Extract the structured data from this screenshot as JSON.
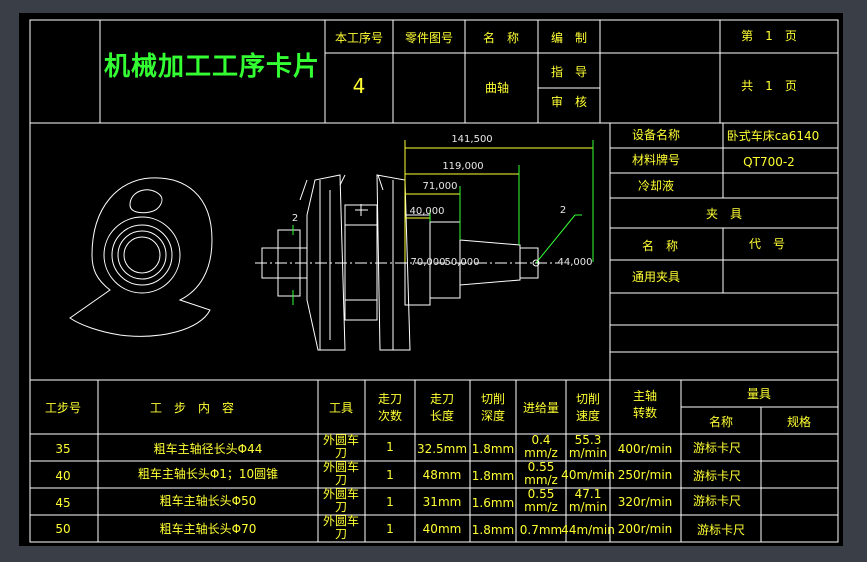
{
  "card_title": "机械加工工序卡片",
  "header": {
    "process_no_label": "本工序号",
    "process_no_value": "4",
    "part_drawing_no_label": "零件图号",
    "name_label": "名　称",
    "part_name": "曲轴",
    "compiled_label": "编　制",
    "guide_label": "指　导",
    "review_label": "审　核",
    "page_label": "第　1　页",
    "total_pages_label": "共　1　页"
  },
  "equipment": {
    "device_name_label": "设备名称",
    "device_name_value": "卧式车床ca6140",
    "material_label": "材料牌号",
    "material_value": "QT700-2",
    "coolant_label": "冷却液",
    "fixture_label": "夹　具",
    "fixture_name_label": "名　称",
    "fixture_code_label": "代　号",
    "fixture_value": "通用夹具"
  },
  "drawing_dims": {
    "d1": "141,500",
    "d2": "119,000",
    "d3": "71,000",
    "d4": "40,000",
    "d5": "44,000",
    "d6": "70,000",
    "d7": "50,000",
    "mark_left": "2",
    "mark_right": "2"
  },
  "table": {
    "headers": {
      "step_no": "工步号",
      "content": "工　步　内　容",
      "tool": "工具",
      "passes": "走刀次数",
      "length": "走刀长度",
      "depth": "切削深度",
      "feed": "进给量",
      "speed": "切削速度",
      "spindle": "主轴转数",
      "gauge": "量具",
      "gauge_name": "名称",
      "gauge_spec": "规格"
    },
    "rows": [
      {
        "no": "35",
        "content": "粗车主轴径长头Φ44",
        "tool": "外圆车刀",
        "passes": "1",
        "length": "32.5mm",
        "depth": "1.8mm",
        "feed": "0.4 mm/z",
        "speed": "55.3 m/min",
        "spindle": "400r/min",
        "gauge": "游标卡尺"
      },
      {
        "no": "40",
        "content": "粗车主轴长头Φ1；10圆锥",
        "tool": "外圆车刀",
        "passes": "1",
        "length": "48mm",
        "depth": "1.8mm",
        "feed": "0.55 mm/z",
        "speed": "40m/min",
        "spindle": "250r/min",
        "gauge": "游标卡尺"
      },
      {
        "no": "45",
        "content": "粗车主轴长头Φ50",
        "tool": "外圆车刀",
        "passes": "1",
        "length": "31mm",
        "depth": "1.6mm",
        "feed": "0.55 mm/z",
        "speed": "47.1 m/min",
        "spindle": "320r/min",
        "gauge": "游标卡尺"
      },
      {
        "no": "50",
        "content": "粗车主轴长头Φ70",
        "tool": "外圆车刀",
        "passes": "1",
        "length": "40mm",
        "depth": "1.8mm",
        "feed": "0.7mm",
        "speed": "44m/min",
        "spindle": "200r/min",
        "gauge": "游标卡尺"
      }
    ]
  },
  "colors": {
    "background": "#3a3f47",
    "sheet": "#000000",
    "line": "#ffffff",
    "text_yellow": "#ffff33",
    "text_green": "#33ff33"
  }
}
